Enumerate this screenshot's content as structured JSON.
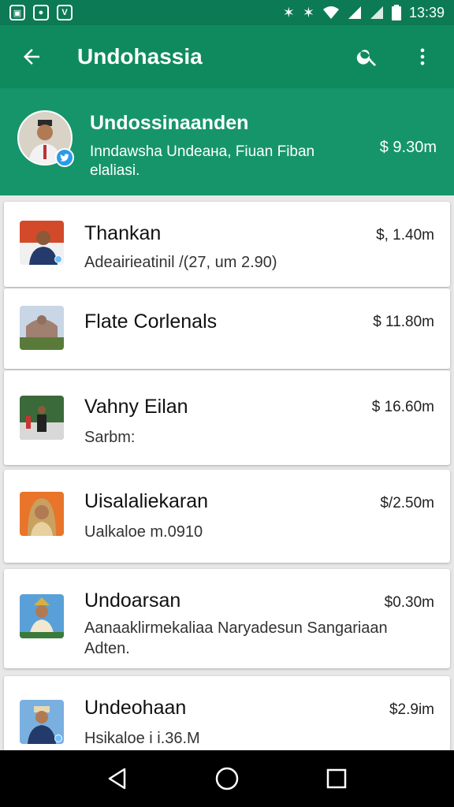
{
  "status_bar": {
    "time": "13:39",
    "left_icons": [
      "notification-icon",
      "record-icon",
      "app-v-icon"
    ],
    "right_icons": [
      "nfc-icon",
      "nfc-icon-2",
      "wifi-icon",
      "signal-icon",
      "signal-icon-2",
      "battery-icon"
    ]
  },
  "app_bar": {
    "title": "Undohassia",
    "back_icon": "arrow-left-icon",
    "search_icon": "search-icon",
    "menu_icon": "more-vert-icon"
  },
  "header": {
    "title": "Undossinaanden",
    "subtitle": "Inndawsha Undeaна, Fiuan Fiban elaliasi.",
    "amount": "$ 9.30m"
  },
  "items": [
    {
      "title": "Thankan",
      "subtitle": "Adeairieatinil /(27, um 2.90)",
      "amount": "$, 1.40m"
    },
    {
      "title": "Flate Corlenals",
      "subtitle": "",
      "amount": "$ 11.80m"
    },
    {
      "title": "Vahny Eilan",
      "subtitle": "Sarbm:",
      "amount": "$ 16.60m"
    },
    {
      "title": "Uisalaliekaran",
      "subtitle": "Ualkaloe m.0910",
      "amount": "$/2.50m"
    },
    {
      "title": "Undoarsan",
      "subtitle": "Aanaaklirmekaliaa Naryadesun Sangariaan Adten.",
      "amount": "$0.30m"
    },
    {
      "title": "Undeohaan",
      "subtitle": "Hsikaloe i i.36.M",
      "amount": "$2.9im"
    }
  ],
  "colors": {
    "app_bar": "#0f8a5f",
    "header": "#16956a",
    "status_bar": "#0c7a55"
  }
}
